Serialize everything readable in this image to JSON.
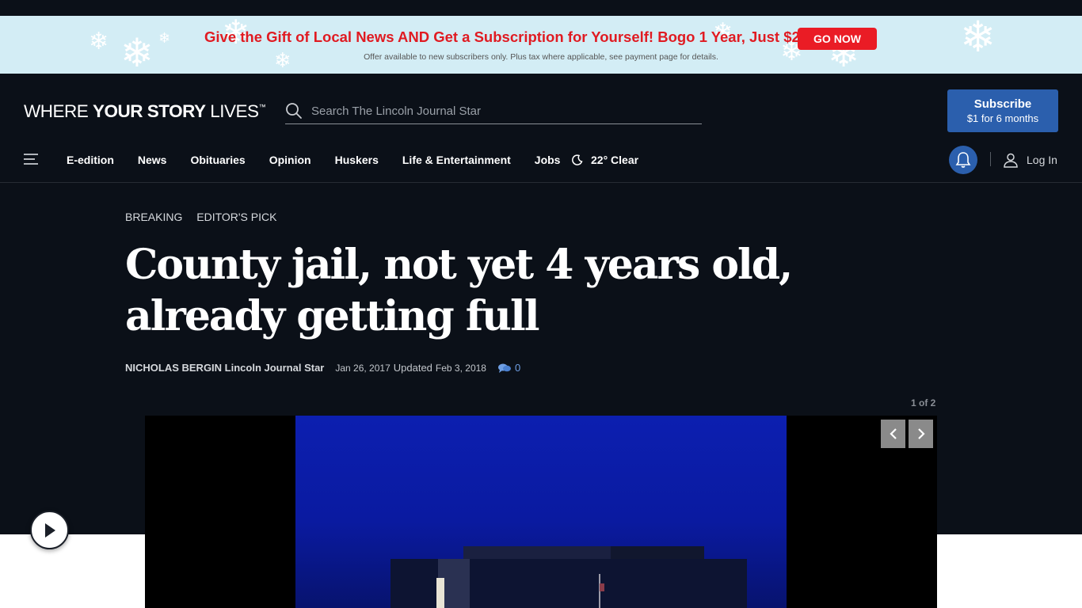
{
  "promo": {
    "headline": "Give the Gift of Local News AND Get a Subscription for Yourself! Bogo 1 Year, Just $20!",
    "subtext": "Offer available to new subscribers only. Plus tax where applicable, see payment page for details.",
    "cta": "GO NOW",
    "accent_color": "#e01b22",
    "background_color": "#d3edf5"
  },
  "header": {
    "logo_light_1": "WHERE ",
    "logo_bold": "YOUR STORY",
    "logo_light_2": " LIVES",
    "logo_tm": "™",
    "search_placeholder": "Search The Lincoln Journal Star",
    "subscribe_title": "Subscribe",
    "subscribe_offer": "$1 for 6 months",
    "brand_color": "#2b5fad"
  },
  "nav": {
    "items": [
      "E-edition",
      "News",
      "Obituaries",
      "Opinion",
      "Huskers",
      "Life & Entertainment",
      "Jobs"
    ],
    "weather": "22° Clear",
    "login": "Log In"
  },
  "article": {
    "labels": [
      "BREAKING",
      "EDITOR'S PICK"
    ],
    "headline": "County jail, not yet 4 years old, already getting full",
    "author": "NICHOLAS BERGIN Lincoln Journal Star",
    "published": "Jan 26, 2017",
    "updated_label": "Updated",
    "updated": "Feb 3, 2018",
    "comment_count": "0"
  },
  "gallery": {
    "counter": "1 of 2"
  }
}
